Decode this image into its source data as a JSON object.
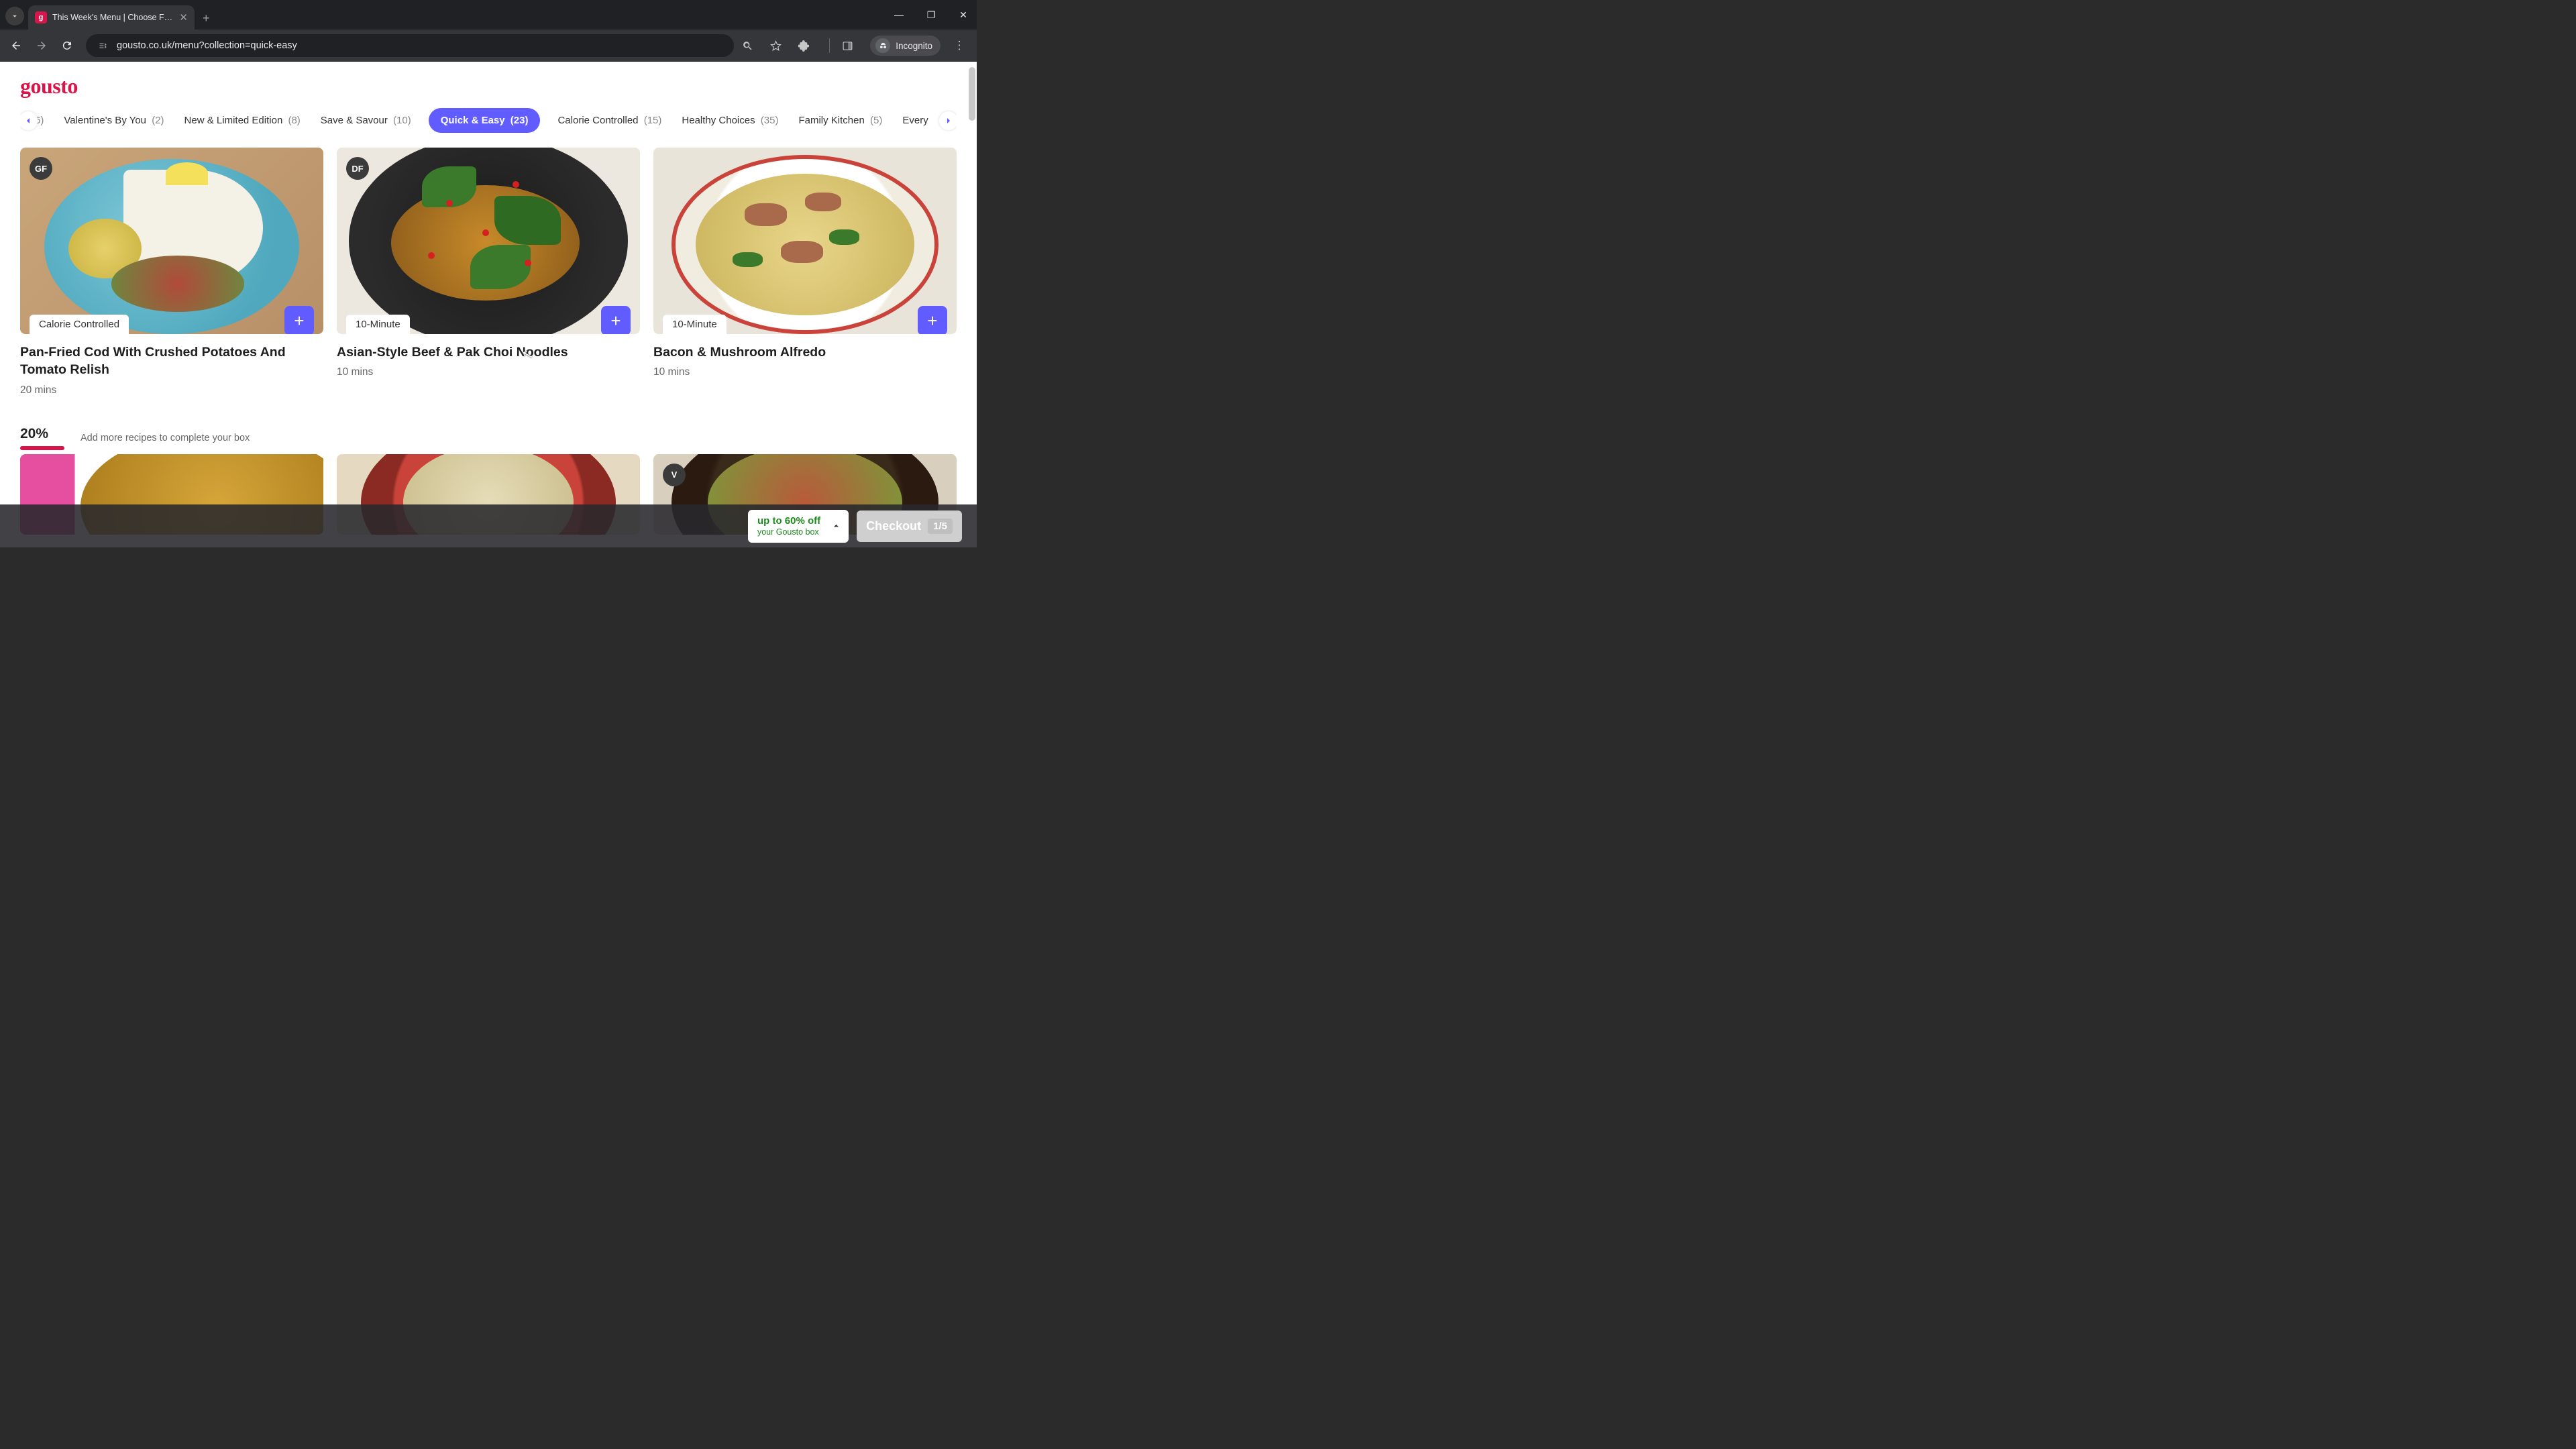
{
  "browser": {
    "tab_title": "This Week's Menu | Choose Fro…",
    "url": "gousto.co.uk/menu?collection=quick-easy",
    "incognito_label": "Incognito"
  },
  "brand": "gousto",
  "filters": {
    "left_trunc": "6)",
    "items": [
      {
        "label": "Valentine's By You",
        "count": "(2)"
      },
      {
        "label": "New & Limited Edition",
        "count": "(8)"
      },
      {
        "label": "Save & Savour",
        "count": "(10)"
      },
      {
        "label": "Quick & Easy",
        "count": "(23)",
        "active": true
      },
      {
        "label": "Calorie Controlled",
        "count": "(15)"
      },
      {
        "label": "Healthy Choices",
        "count": "(35)"
      },
      {
        "label": "Family Kitchen",
        "count": "(5)"
      }
    ],
    "right_trunc": "Every"
  },
  "cards": [
    {
      "badge": "GF",
      "chip": "Calorie Controlled",
      "title": "Pan-Fried Cod With Crushed Potatoes And Tomato Relish",
      "meta": "20 mins"
    },
    {
      "badge": "DF",
      "chip": "10-Minute",
      "title": "Asian-Style Beef & Pak Choi Noodles",
      "meta": "10 mins"
    },
    {
      "badge": "",
      "chip": "10-Minute",
      "title": "Bacon & Mushroom Alfredo",
      "meta": "10 mins"
    }
  ],
  "progress": {
    "pct": "20%",
    "text": "Add more recipes to complete your box",
    "fill_pct": 20
  },
  "row2_badges": [
    "",
    "",
    "V"
  ],
  "promo": {
    "title": "up to 60% off",
    "sub": "your Gousto box"
  },
  "checkout": {
    "label": "Checkout",
    "counter": "1/5"
  }
}
